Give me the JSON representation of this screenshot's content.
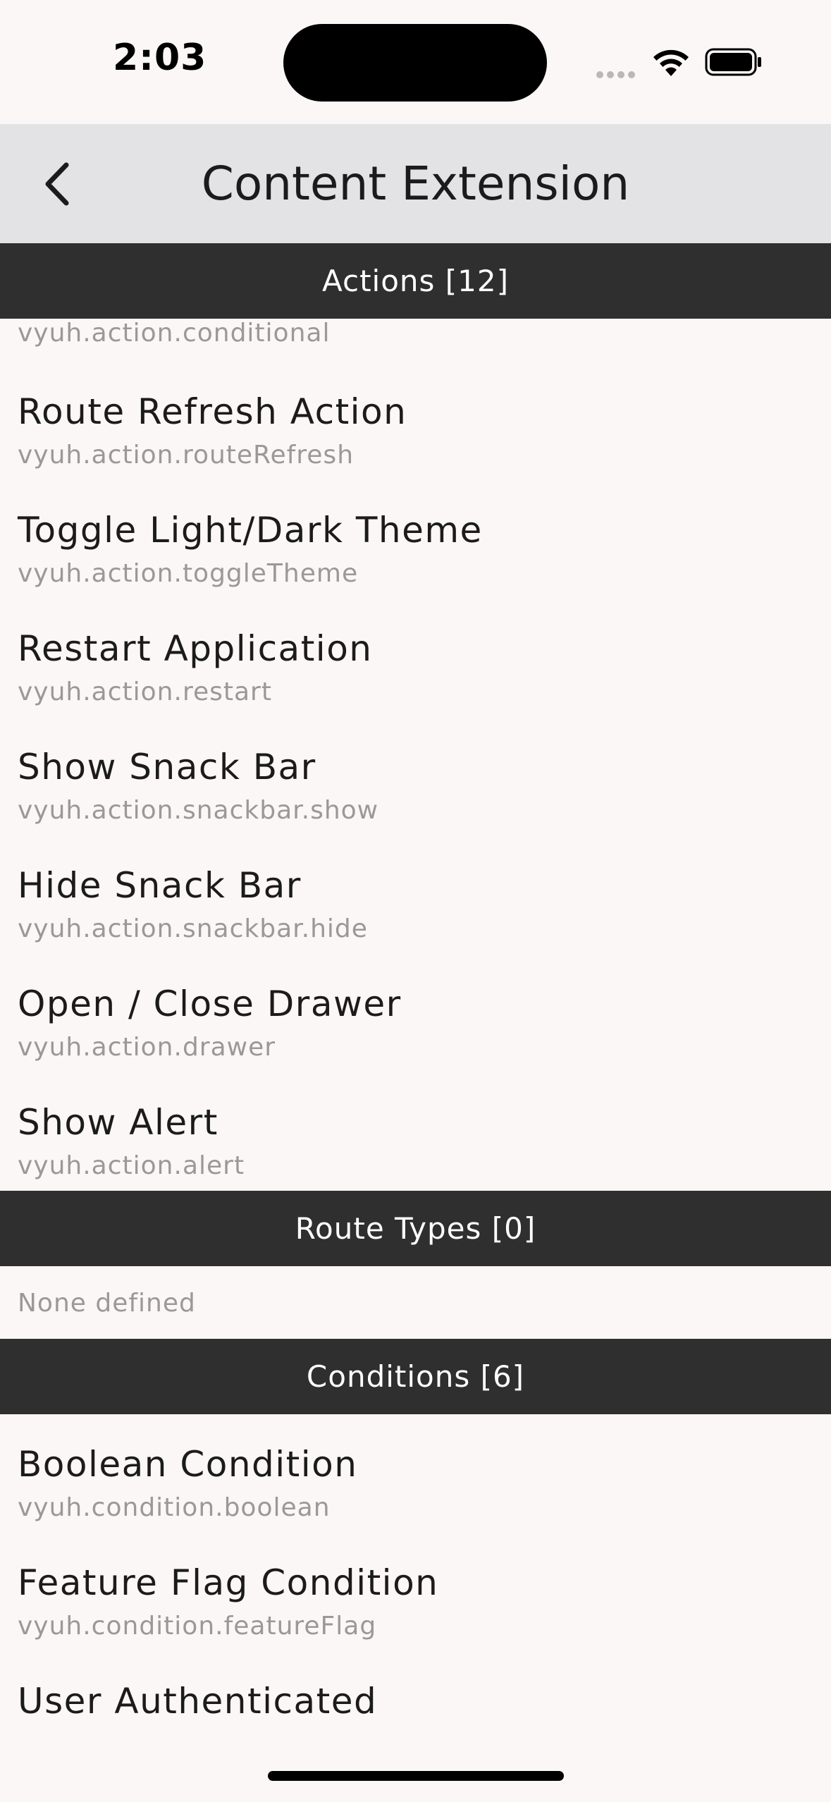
{
  "status_bar": {
    "time": "2:03"
  },
  "header": {
    "title": "Content Extension"
  },
  "sections": {
    "actions": {
      "title": "Actions [12]",
      "partial_subtitle": "vyuh.action.conditional",
      "items": [
        {
          "title": "Route Refresh Action",
          "subtitle": "vyuh.action.routeRefresh"
        },
        {
          "title": "Toggle Light/Dark Theme",
          "subtitle": "vyuh.action.toggleTheme"
        },
        {
          "title": "Restart Application",
          "subtitle": "vyuh.action.restart"
        },
        {
          "title": "Show Snack Bar",
          "subtitle": "vyuh.action.snackbar.show"
        },
        {
          "title": "Hide Snack Bar",
          "subtitle": "vyuh.action.snackbar.hide"
        },
        {
          "title": "Open / Close Drawer",
          "subtitle": "vyuh.action.drawer"
        },
        {
          "title": "Show Alert",
          "subtitle": "vyuh.action.alert"
        }
      ]
    },
    "route_types": {
      "title": "Route Types [0]",
      "empty_text": "None defined"
    },
    "conditions": {
      "title": "Conditions [6]",
      "items": [
        {
          "title": "Boolean Condition",
          "subtitle": "vyuh.condition.boolean"
        },
        {
          "title": "Feature Flag Condition",
          "subtitle": "vyuh.condition.featureFlag"
        },
        {
          "title": "User Authenticated",
          "subtitle": ""
        }
      ]
    }
  },
  "colors": {
    "background": "#faf7f6",
    "nav_bar": "#e3e2e4",
    "section_header": "#2f2f2f",
    "subtitle": "#9a9898"
  }
}
